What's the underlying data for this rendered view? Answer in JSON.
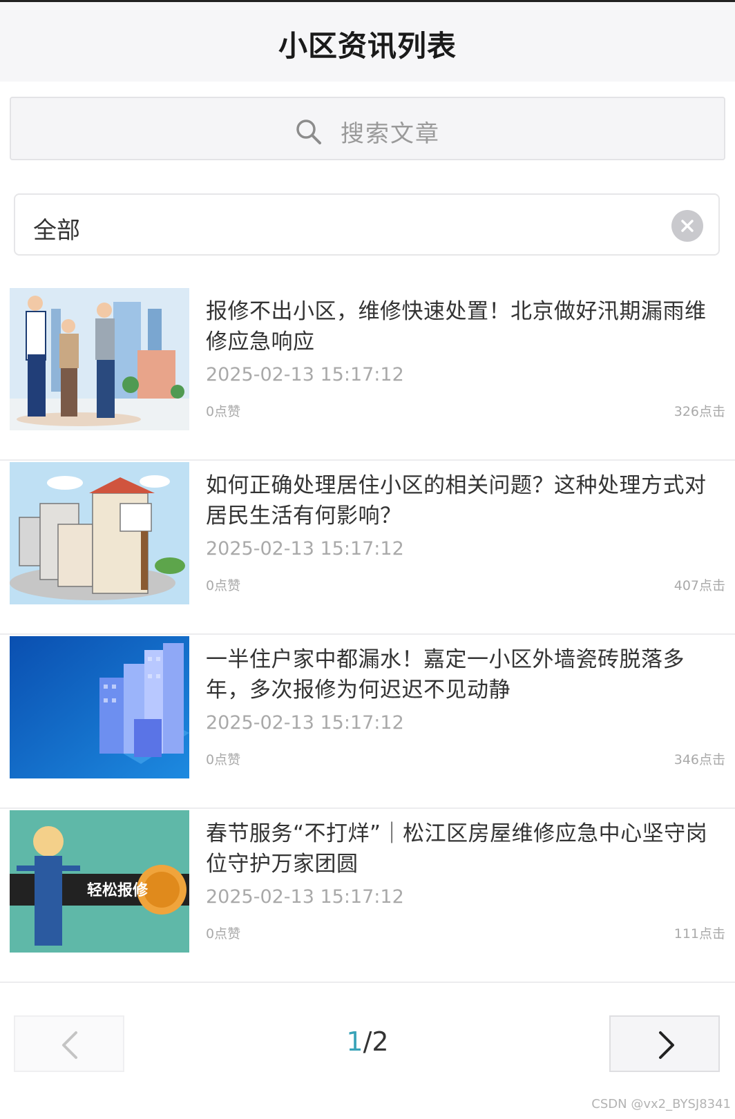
{
  "header": {
    "title": "小区资讯列表"
  },
  "search": {
    "placeholder": "搜索文章",
    "icon": "search-icon"
  },
  "filter": {
    "label": "全部",
    "clear_icon": "clear-icon"
  },
  "articles": [
    {
      "title": "报修不出小区，维修快速处置！北京做好汛期漏雨维修应急响应",
      "date": "2025-02-13 15:17:12",
      "likes": "0点赞",
      "clicks": "326点击"
    },
    {
      "title": "如何正确处理居住小区的相关问题？这种处理方式对居民生活有何影响？",
      "date": "2025-02-13 15:17:12",
      "likes": "0点赞",
      "clicks": "407点击"
    },
    {
      "title": "一半住户家中都漏水！嘉定一小区外墙瓷砖脱落多年，多次报修为何迟迟不见动静",
      "date": "2025-02-13 15:17:12",
      "likes": "0点赞",
      "clicks": "346点击"
    },
    {
      "title": "春节服务“不打烊”｜松江区房屋维修应急中心坚守岗位守护万家团圆",
      "date": "2025-02-13 15:17:12",
      "likes": "0点赞",
      "clicks": "111点击",
      "thumb_text": "轻松报修"
    }
  ],
  "pagination": {
    "current": "1",
    "separator": "/",
    "total": "2"
  },
  "watermark": "CSDN @vx2_BYSJ8341",
  "colors": {
    "accent": "#3aa3b8",
    "header_bg": "#f6f6f8",
    "muted_text": "#a9a9a9"
  }
}
